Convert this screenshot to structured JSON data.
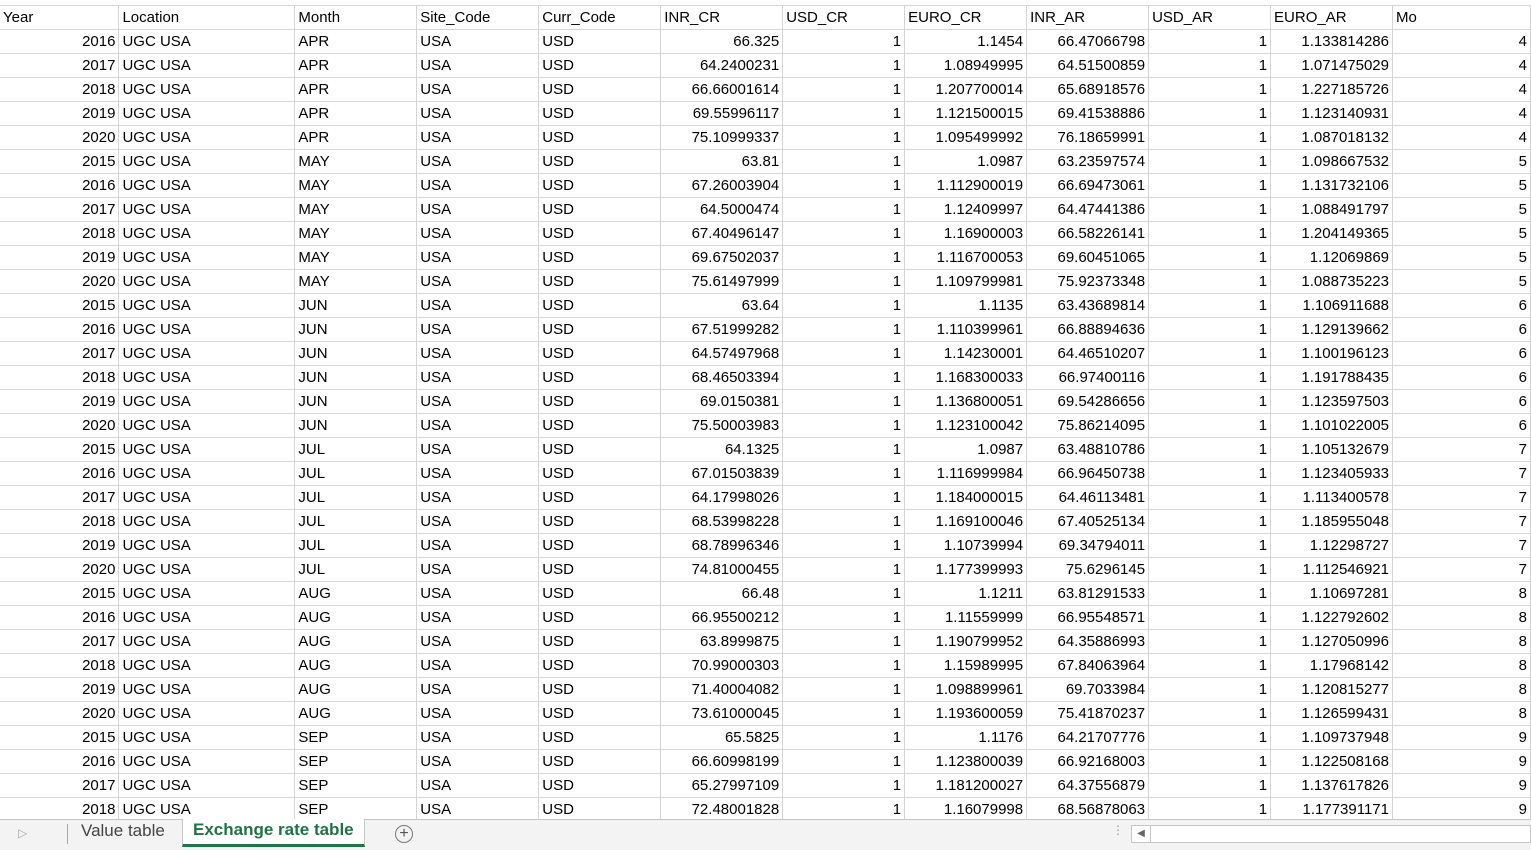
{
  "sheet": {
    "columns": [
      "Year",
      "Location",
      "Month",
      "Site_Code",
      "Curr_Code",
      "INR_CR",
      "USD_CR",
      "EURO_CR",
      "INR_AR",
      "USD_AR",
      "EURO_AR",
      "Mo"
    ],
    "rows": [
      [
        "2016",
        "UGC USA",
        "APR",
        "USA",
        "USD",
        "66.325",
        "1",
        "1.1454",
        "66.47066798",
        "1",
        "1.133814286",
        "4"
      ],
      [
        "2017",
        "UGC USA",
        "APR",
        "USA",
        "USD",
        "64.2400231",
        "1",
        "1.08949995",
        "64.51500859",
        "1",
        "1.071475029",
        "4"
      ],
      [
        "2018",
        "UGC USA",
        "APR",
        "USA",
        "USD",
        "66.66001614",
        "1",
        "1.207700014",
        "65.68918576",
        "1",
        "1.227185726",
        "4"
      ],
      [
        "2019",
        "UGC USA",
        "APR",
        "USA",
        "USD",
        "69.55996117",
        "1",
        "1.121500015",
        "69.41538886",
        "1",
        "1.123140931",
        "4"
      ],
      [
        "2020",
        "UGC USA",
        "APR",
        "USA",
        "USD",
        "75.10999337",
        "1",
        "1.095499992",
        "76.18659991",
        "1",
        "1.087018132",
        "4"
      ],
      [
        "2015",
        "UGC USA",
        "MAY",
        "USA",
        "USD",
        "63.81",
        "1",
        "1.0987",
        "63.23597574",
        "1",
        "1.098667532",
        "5"
      ],
      [
        "2016",
        "UGC USA",
        "MAY",
        "USA",
        "USD",
        "67.26003904",
        "1",
        "1.112900019",
        "66.69473061",
        "1",
        "1.131732106",
        "5"
      ],
      [
        "2017",
        "UGC USA",
        "MAY",
        "USA",
        "USD",
        "64.5000474",
        "1",
        "1.12409997",
        "64.47441386",
        "1",
        "1.088491797",
        "5"
      ],
      [
        "2018",
        "UGC USA",
        "MAY",
        "USA",
        "USD",
        "67.40496147",
        "1",
        "1.16900003",
        "66.58226141",
        "1",
        "1.204149365",
        "5"
      ],
      [
        "2019",
        "UGC USA",
        "MAY",
        "USA",
        "USD",
        "69.67502037",
        "1",
        "1.116700053",
        "69.60451065",
        "1",
        "1.12069869",
        "5"
      ],
      [
        "2020",
        "UGC USA",
        "MAY",
        "USA",
        "USD",
        "75.61497999",
        "1",
        "1.109799981",
        "75.92373348",
        "1",
        "1.088735223",
        "5"
      ],
      [
        "2015",
        "UGC USA",
        "JUN",
        "USA",
        "USD",
        "63.64",
        "1",
        "1.1135",
        "63.43689814",
        "1",
        "1.106911688",
        "6"
      ],
      [
        "2016",
        "UGC USA",
        "JUN",
        "USA",
        "USD",
        "67.51999282",
        "1",
        "1.110399961",
        "66.88894636",
        "1",
        "1.129139662",
        "6"
      ],
      [
        "2017",
        "UGC USA",
        "JUN",
        "USA",
        "USD",
        "64.57497968",
        "1",
        "1.14230001",
        "64.46510207",
        "1",
        "1.100196123",
        "6"
      ],
      [
        "2018",
        "UGC USA",
        "JUN",
        "USA",
        "USD",
        "68.46503394",
        "1",
        "1.168300033",
        "66.97400116",
        "1",
        "1.191788435",
        "6"
      ],
      [
        "2019",
        "UGC USA",
        "JUN",
        "USA",
        "USD",
        "69.0150381",
        "1",
        "1.136800051",
        "69.54286656",
        "1",
        "1.123597503",
        "6"
      ],
      [
        "2020",
        "UGC USA",
        "JUN",
        "USA",
        "USD",
        "75.50003983",
        "1",
        "1.123100042",
        "75.86214095",
        "1",
        "1.101022005",
        "6"
      ],
      [
        "2015",
        "UGC USA",
        "JUL",
        "USA",
        "USD",
        "64.1325",
        "1",
        "1.0987",
        "63.48810786",
        "1",
        "1.105132679",
        "7"
      ],
      [
        "2016",
        "UGC USA",
        "JUL",
        "USA",
        "USD",
        "67.01503839",
        "1",
        "1.116999984",
        "66.96450738",
        "1",
        "1.123405933",
        "7"
      ],
      [
        "2017",
        "UGC USA",
        "JUL",
        "USA",
        "USD",
        "64.17998026",
        "1",
        "1.184000015",
        "64.46113481",
        "1",
        "1.113400578",
        "7"
      ],
      [
        "2018",
        "UGC USA",
        "JUL",
        "USA",
        "USD",
        "68.53998228",
        "1",
        "1.169100046",
        "67.40525134",
        "1",
        "1.185955048",
        "7"
      ],
      [
        "2019",
        "UGC USA",
        "JUL",
        "USA",
        "USD",
        "68.78996346",
        "1",
        "1.10739994",
        "69.34794011",
        "1",
        "1.12298727",
        "7"
      ],
      [
        "2020",
        "UGC USA",
        "JUL",
        "USA",
        "USD",
        "74.81000455",
        "1",
        "1.177399993",
        "75.6296145",
        "1",
        "1.112546921",
        "7"
      ],
      [
        "2015",
        "UGC USA",
        "AUG",
        "USA",
        "USD",
        "66.48",
        "1",
        "1.1211",
        "63.81291533",
        "1",
        "1.10697281",
        "8"
      ],
      [
        "2016",
        "UGC USA",
        "AUG",
        "USA",
        "USD",
        "66.95500212",
        "1",
        "1.11559999",
        "66.95548571",
        "1",
        "1.122792602",
        "8"
      ],
      [
        "2017",
        "UGC USA",
        "AUG",
        "USA",
        "USD",
        "63.8999875",
        "1",
        "1.190799952",
        "64.35886993",
        "1",
        "1.127050996",
        "8"
      ],
      [
        "2018",
        "UGC USA",
        "AUG",
        "USA",
        "USD",
        "70.99000303",
        "1",
        "1.15989995",
        "67.84063964",
        "1",
        "1.17968142",
        "8"
      ],
      [
        "2019",
        "UGC USA",
        "AUG",
        "USA",
        "USD",
        "71.40004082",
        "1",
        "1.098899961",
        "69.7033984",
        "1",
        "1.120815277",
        "8"
      ],
      [
        "2020",
        "UGC USA",
        "AUG",
        "USA",
        "USD",
        "73.61000045",
        "1",
        "1.193600059",
        "75.41870237",
        "1",
        "1.126599431",
        "8"
      ],
      [
        "2015",
        "UGC USA",
        "SEP",
        "USA",
        "USD",
        "65.5825",
        "1",
        "1.1176",
        "64.21707776",
        "1",
        "1.109737948",
        "9"
      ],
      [
        "2016",
        "UGC USA",
        "SEP",
        "USA",
        "USD",
        "66.60998199",
        "1",
        "1.123800039",
        "66.92168003",
        "1",
        "1.122508168",
        "9"
      ],
      [
        "2017",
        "UGC USA",
        "SEP",
        "USA",
        "USD",
        "65.27997109",
        "1",
        "1.181200027",
        "64.37556879",
        "1",
        "1.137617826",
        "9"
      ],
      [
        "2018",
        "UGC USA",
        "SEP",
        "USA",
        "USD",
        "72.48001828",
        "1",
        "1.16079998",
        "68.56878063",
        "1",
        "1.177391171",
        "9"
      ]
    ]
  },
  "tabs": {
    "items": [
      "Value table",
      "Exchange rate table"
    ],
    "active": "Exchange rate table",
    "add_symbol": "+",
    "nav_left_symbol": "◀"
  },
  "colors": {
    "accent": "#217346",
    "gridline": "#d4d4d4",
    "tabbar_bg": "#f3f3f3"
  }
}
